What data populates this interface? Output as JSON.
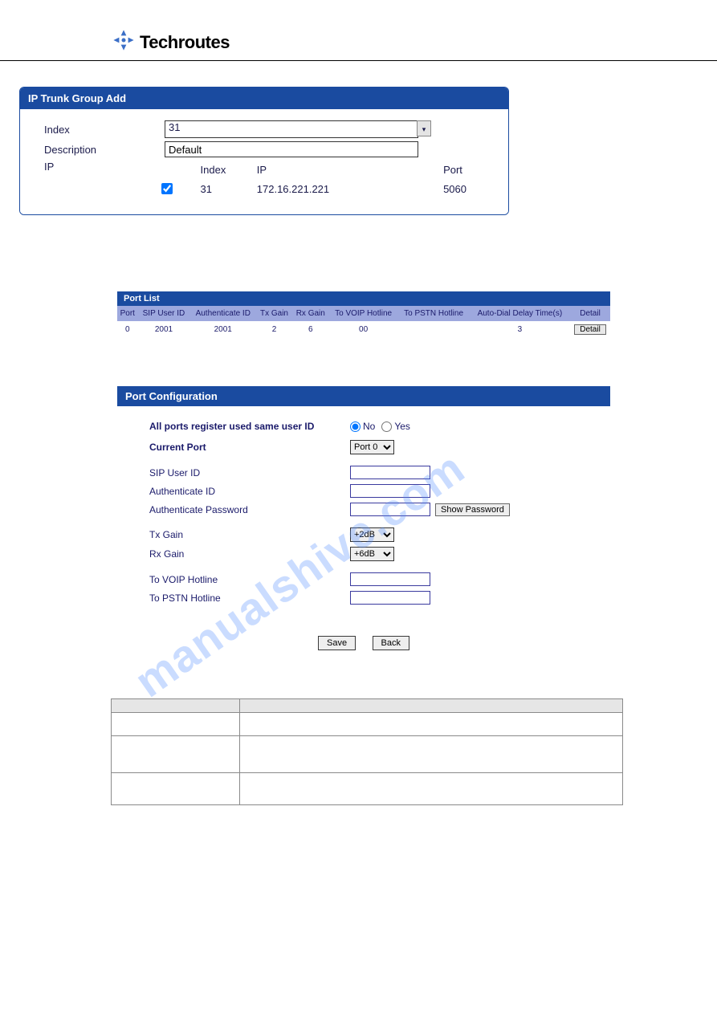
{
  "brand": "Techroutes",
  "iptrunk": {
    "title": "IP Trunk Group Add",
    "labels": {
      "index": "Index",
      "description": "Description",
      "ip": "IP"
    },
    "index_value": "31",
    "description_value": "Default",
    "cols": {
      "index": "Index",
      "ip": "IP",
      "port": "Port"
    },
    "row": {
      "checked": true,
      "index": "31",
      "ip": "172.16.221.221",
      "port": "5060"
    }
  },
  "portlist": {
    "title": "Port List",
    "headers": [
      "Port",
      "SIP User ID",
      "Authenticate ID",
      "Tx Gain",
      "Rx Gain",
      "To VOIP Hotline",
      "To PSTN Hotline",
      "Auto-Dial Delay Time(s)",
      "Detail"
    ],
    "row": {
      "port": "0",
      "sip": "2001",
      "auth": "2001",
      "tx": "2",
      "rx": "6",
      "voip": "00",
      "pstn": "",
      "delay": "3",
      "detail_btn": "Detail"
    }
  },
  "portcfg": {
    "title": "Port Configuration",
    "all_ports_label": "All ports register used same user ID",
    "no": "No",
    "yes": "Yes",
    "current_port_label": "Current Port",
    "current_port_value": "Port 0",
    "sip_label": "SIP User ID",
    "auth_id_label": "Authenticate ID",
    "auth_pw_label": "Authenticate Password",
    "show_pw": "Show Password",
    "tx_label": "Tx Gain",
    "tx_value": "+2dB",
    "rx_label": "Rx Gain",
    "rx_value": "+6dB",
    "voip_label": "To VOIP Hotline",
    "pstn_label": "To PSTN Hotline",
    "save": "Save",
    "back": "Back"
  },
  "desc": {
    "h1": "",
    "h2": "",
    "rows": [
      {
        "a": "",
        "b": ""
      },
      {
        "a": "",
        "b": ""
      },
      {
        "a": "",
        "b": ""
      }
    ]
  },
  "watermark": "manualshive.com"
}
